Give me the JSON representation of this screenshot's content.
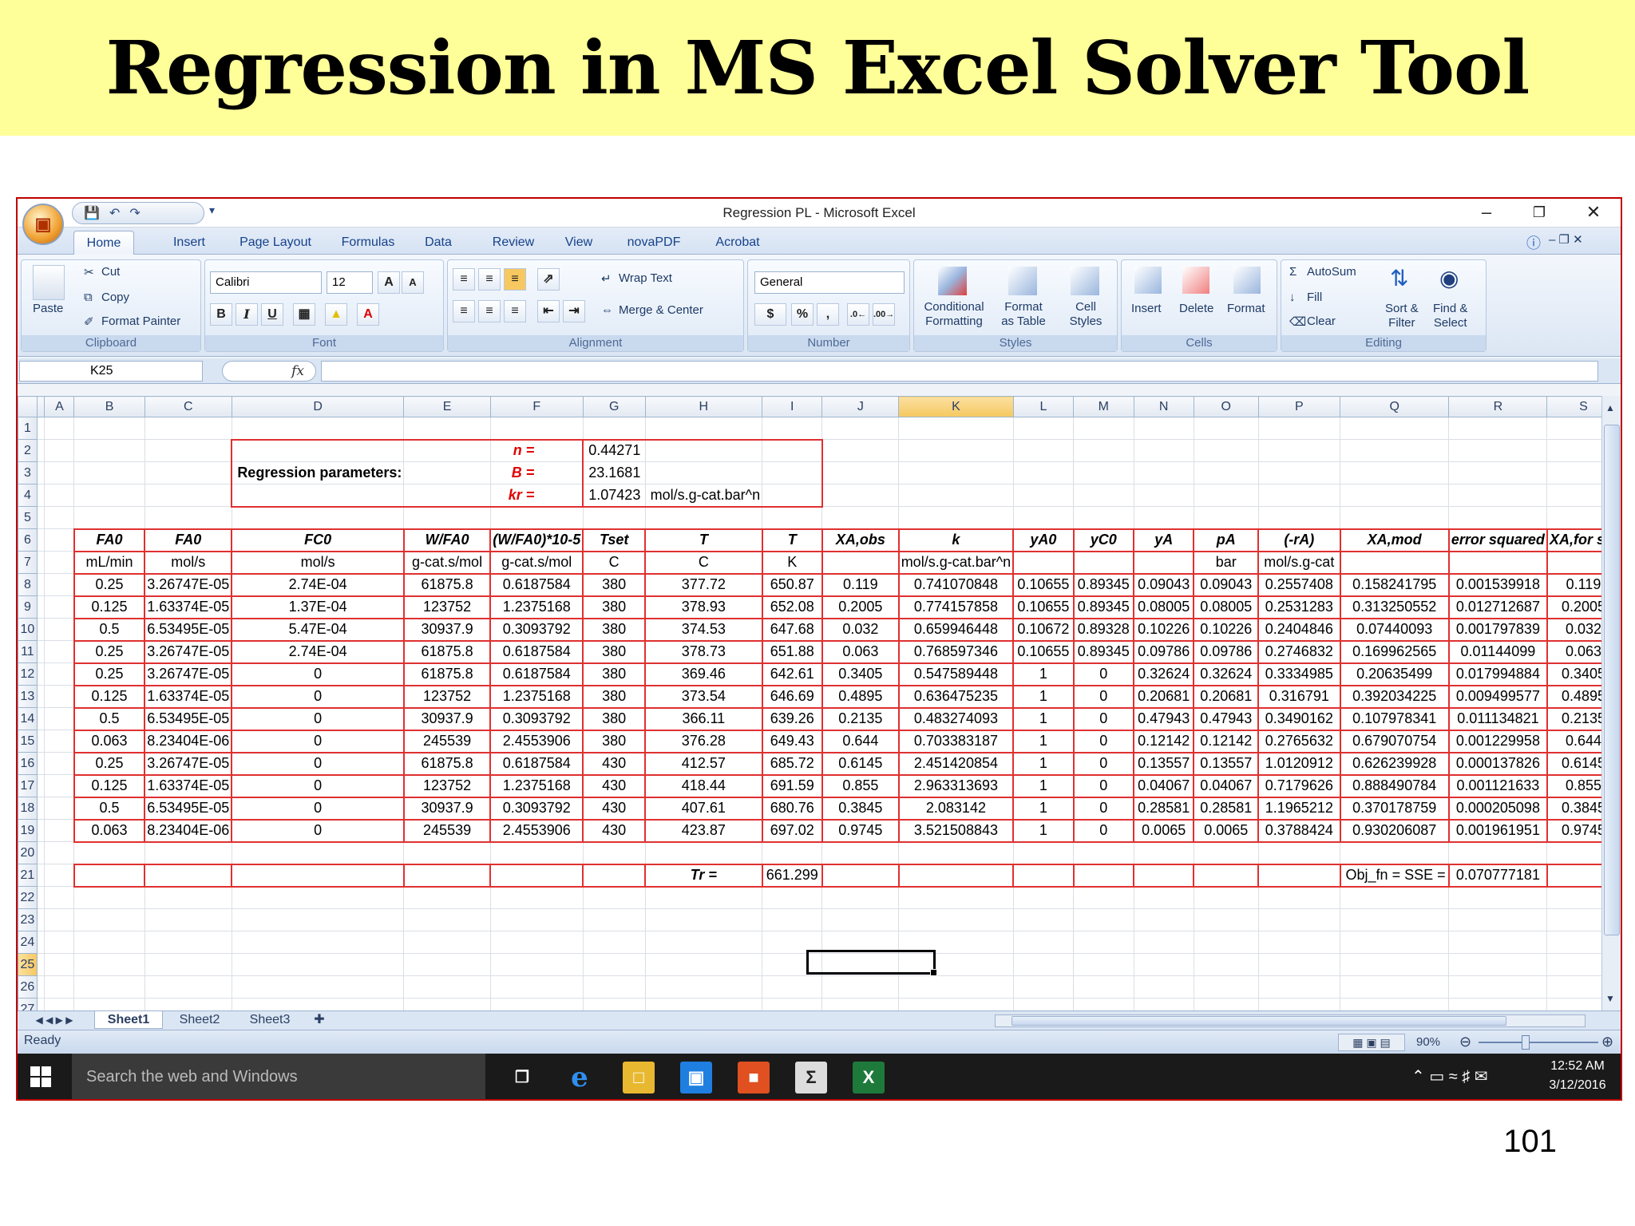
{
  "slide": {
    "title": "Regression in MS Excel Solver Tool",
    "page_number": "101"
  },
  "window": {
    "title": "Regression PL - Microsoft Excel"
  },
  "tabs": [
    "Home",
    "Insert",
    "Page Layout",
    "Formulas",
    "Data",
    "Review",
    "View",
    "novaPDF",
    "Acrobat"
  ],
  "ribbon": {
    "clipboard": {
      "paste": "Paste",
      "cut": "Cut",
      "copy": "Copy",
      "format_painter": "Format Painter",
      "label": "Clipboard"
    },
    "font": {
      "name": "Calibri",
      "size": "12",
      "label": "Font",
      "bold": "B",
      "italic": "I",
      "underline": "U",
      "grow": "A",
      "shrink": "A"
    },
    "alignment": {
      "wrap_text": "Wrap Text",
      "merge_center": "Merge & Center",
      "label": "Alignment"
    },
    "number": {
      "format": "General",
      "currency": "$",
      "percent": "%",
      "comma": ",",
      "label": "Number"
    },
    "styles": {
      "conditional": "Conditional",
      "conditional2": "Formatting",
      "format_table": "Format",
      "format_table2": "as Table",
      "cell_styles": "Cell",
      "cell_styles2": "Styles",
      "label": "Styles"
    },
    "cells": {
      "insert": "Insert",
      "delete": "Delete",
      "format": "Format",
      "label": "Cells"
    },
    "editing": {
      "autosum": "AutoSum",
      "fill": "Fill",
      "clear": "Clear",
      "sort": "Sort &",
      "sort2": "Filter",
      "find": "Find &",
      "find2": "Select",
      "label": "Editing"
    }
  },
  "formula_bar": {
    "name_box": "K25",
    "fx": "fx",
    "value": ""
  },
  "columns": [
    "A",
    "B",
    "C",
    "D",
    "E",
    "F",
    "G",
    "H",
    "I",
    "J",
    "K",
    "L",
    "M",
    "N",
    "O",
    "P",
    "Q",
    "R",
    "S"
  ],
  "params": {
    "title": "Regression parameters:",
    "n_label": "n =",
    "n_value": "0.44271",
    "b_label": "B =",
    "b_value": "23.1681",
    "kr_label": "kr =",
    "kr_value": "1.07423",
    "kr_unit": "mol/s.g-cat.bar^n"
  },
  "headers": [
    "FA0",
    "FA0",
    "FC0",
    "W/FA0",
    "(W/FA0)*10-5",
    "Tset",
    "T",
    "T",
    "XA,obs",
    "k",
    "yA0",
    "yC0",
    "yA",
    "pA",
    "(-rA)",
    "XA,mod",
    "error squared",
    "XA,for sol"
  ],
  "units": [
    "mL/min",
    "mol/s",
    "mol/s",
    "g-cat.s/mol",
    "g-cat.s/mol",
    "C",
    "C",
    "K",
    "",
    "mol/s.g-cat.bar^n",
    "",
    "",
    "",
    "bar",
    "mol/s.g-cat",
    "",
    "",
    ""
  ],
  "rows": [
    [
      "0.25",
      "3.26747E-05",
      "2.74E-04",
      "61875.8",
      "0.6187584",
      "380",
      "377.72",
      "650.87",
      "0.119",
      "0.741070848",
      "0.10655",
      "0.89345",
      "0.09043",
      "0.09043",
      "0.2557408",
      "0.158241795",
      "0.001539918",
      "0.119"
    ],
    [
      "0.125",
      "1.63374E-05",
      "1.37E-04",
      "123752",
      "1.2375168",
      "380",
      "378.93",
      "652.08",
      "0.2005",
      "0.774157858",
      "0.10655",
      "0.89345",
      "0.08005",
      "0.08005",
      "0.2531283",
      "0.313250552",
      "0.012712687",
      "0.2005"
    ],
    [
      "0.5",
      "6.53495E-05",
      "5.47E-04",
      "30937.9",
      "0.3093792",
      "380",
      "374.53",
      "647.68",
      "0.032",
      "0.659946448",
      "0.10672",
      "0.89328",
      "0.10226",
      "0.10226",
      "0.2404846",
      "0.07440093",
      "0.001797839",
      "0.032"
    ],
    [
      "0.25",
      "3.26747E-05",
      "2.74E-04",
      "61875.8",
      "0.6187584",
      "380",
      "378.73",
      "651.88",
      "0.063",
      "0.768597346",
      "0.10655",
      "0.89345",
      "0.09786",
      "0.09786",
      "0.2746832",
      "0.169962565",
      "0.01144099",
      "0.063"
    ],
    [
      "0.25",
      "3.26747E-05",
      "0",
      "61875.8",
      "0.6187584",
      "380",
      "369.46",
      "642.61",
      "0.3405",
      "0.547589448",
      "1",
      "0",
      "0.32624",
      "0.32624",
      "0.3334985",
      "0.20635499",
      "0.017994884",
      "0.3405"
    ],
    [
      "0.125",
      "1.63374E-05",
      "0",
      "123752",
      "1.2375168",
      "380",
      "373.54",
      "646.69",
      "0.4895",
      "0.636475235",
      "1",
      "0",
      "0.20681",
      "0.20681",
      "0.316791",
      "0.392034225",
      "0.009499577",
      "0.4895"
    ],
    [
      "0.5",
      "6.53495E-05",
      "0",
      "30937.9",
      "0.3093792",
      "380",
      "366.11",
      "639.26",
      "0.2135",
      "0.483274093",
      "1",
      "0",
      "0.47943",
      "0.47943",
      "0.3490162",
      "0.107978341",
      "0.011134821",
      "0.2135"
    ],
    [
      "0.063",
      "8.23404E-06",
      "0",
      "245539",
      "2.4553906",
      "380",
      "376.28",
      "649.43",
      "0.644",
      "0.703383187",
      "1",
      "0",
      "0.12142",
      "0.12142",
      "0.2765632",
      "0.679070754",
      "0.001229958",
      "0.644"
    ],
    [
      "0.25",
      "3.26747E-05",
      "0",
      "61875.8",
      "0.6187584",
      "430",
      "412.57",
      "685.72",
      "0.6145",
      "2.451420854",
      "1",
      "0",
      "0.13557",
      "0.13557",
      "1.0120912",
      "0.626239928",
      "0.000137826",
      "0.6145"
    ],
    [
      "0.125",
      "1.63374E-05",
      "0",
      "123752",
      "1.2375168",
      "430",
      "418.44",
      "691.59",
      "0.855",
      "2.963313693",
      "1",
      "0",
      "0.04067",
      "0.04067",
      "0.7179626",
      "0.888490784",
      "0.001121633",
      "0.855"
    ],
    [
      "0.5",
      "6.53495E-05",
      "0",
      "30937.9",
      "0.3093792",
      "430",
      "407.61",
      "680.76",
      "0.3845",
      "2.083142",
      "1",
      "0",
      "0.28581",
      "0.28581",
      "1.1965212",
      "0.370178759",
      "0.000205098",
      "0.3845"
    ],
    [
      "0.063",
      "8.23404E-06",
      "0",
      "245539",
      "2.4553906",
      "430",
      "423.87",
      "697.02",
      "0.9745",
      "3.521508843",
      "1",
      "0",
      "0.0065",
      "0.0065",
      "0.3788424",
      "0.930206087",
      "0.001961951",
      "0.9745"
    ]
  ],
  "summary": {
    "tr_label": "Tr =",
    "tr_value": "661.299",
    "obj_label": "Obj_fn = SSE =",
    "obj_value": "0.070777181"
  },
  "sheets": [
    "Sheet1",
    "Sheet2",
    "Sheet3"
  ],
  "status": {
    "ready": "Ready",
    "zoom": "90%"
  },
  "taskbar": {
    "search": "Search the web and Windows",
    "time": "12:52 AM",
    "date": "3/12/2016"
  }
}
